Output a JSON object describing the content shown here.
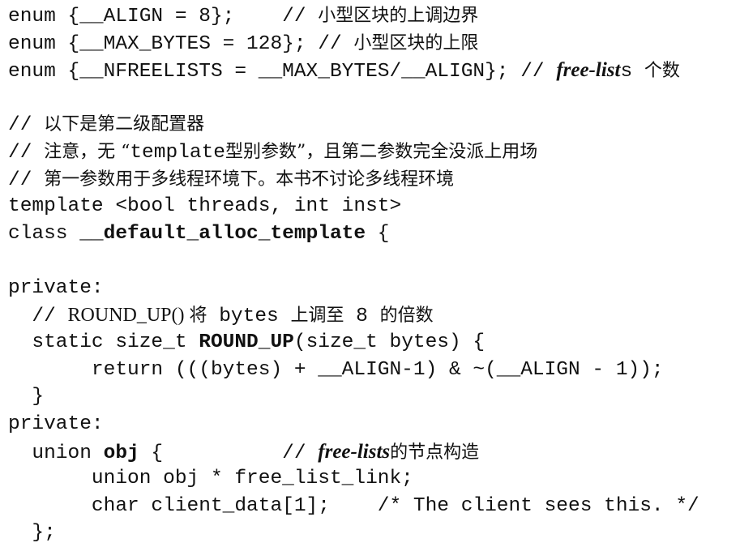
{
  "lines": [
    [
      [
        "code",
        "enum {__ALIGN = 8};    // "
      ],
      [
        "cn",
        "小型区块的上调边界"
      ]
    ],
    [
      [
        "code",
        "enum {__MAX_BYTES = 128}; // "
      ],
      [
        "cn",
        "小型区块的上限"
      ]
    ],
    [
      [
        "code",
        "enum {__NFREELISTS = __MAX_BYTES/__ALIGN}; // "
      ],
      [
        "italic",
        "free-list"
      ],
      [
        "code",
        "s "
      ],
      [
        "cn",
        "个数"
      ]
    ],
    [],
    [
      [
        "code",
        "// "
      ],
      [
        "cn",
        "以下是第二级配置器"
      ]
    ],
    [
      [
        "code",
        "// "
      ],
      [
        "cn",
        "注意，无 “"
      ],
      [
        "code",
        "template"
      ],
      [
        "cn",
        "型别参数”，且第二参数完全没派上用场"
      ]
    ],
    [
      [
        "code",
        "// "
      ],
      [
        "cn",
        "第一参数用于多线程环境下。本书不讨论多线程环境"
      ]
    ],
    [
      [
        "code",
        "template <bool threads, int inst>"
      ]
    ],
    [
      [
        "code",
        "class "
      ],
      [
        "bold",
        "__default_alloc_template"
      ],
      [
        "code",
        " {"
      ]
    ],
    [],
    [
      [
        "code",
        "private:"
      ]
    ],
    [
      [
        "code",
        "  // "
      ],
      [
        "serif",
        "ROUND_UP() "
      ],
      [
        "cn",
        "将"
      ],
      [
        "code",
        " bytes "
      ],
      [
        "cn",
        "上调至"
      ],
      [
        "code",
        " 8 "
      ],
      [
        "cn",
        "的倍数"
      ]
    ],
    [
      [
        "code",
        "  static size_t "
      ],
      [
        "bold",
        "ROUND_UP"
      ],
      [
        "code",
        "(size_t bytes) {"
      ]
    ],
    [
      [
        "code",
        "       return (((bytes) + __ALIGN-1) & ~(__ALIGN - 1));"
      ]
    ],
    [
      [
        "code",
        "  }"
      ]
    ],
    [
      [
        "code",
        "private:"
      ]
    ],
    [
      [
        "code",
        "  union "
      ],
      [
        "bold",
        "obj"
      ],
      [
        "code",
        " {          // "
      ],
      [
        "italic",
        "free-lists"
      ],
      [
        "cn",
        "的节点构造"
      ]
    ],
    [
      [
        "code",
        "       union obj * free_list_link;"
      ]
    ],
    [
      [
        "code",
        "       char client_data[1];    /* The client sees this. */"
      ]
    ],
    [
      [
        "code",
        "  };"
      ]
    ]
  ]
}
